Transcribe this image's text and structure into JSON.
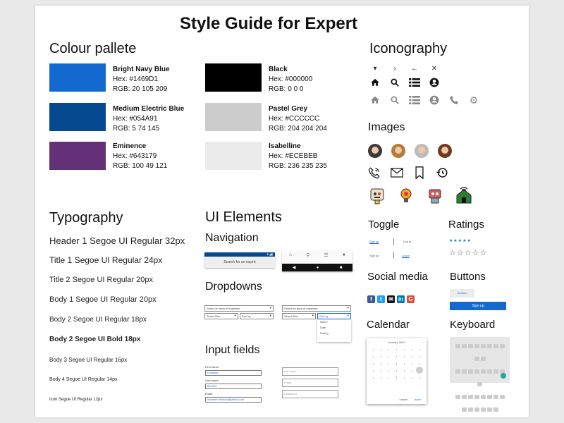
{
  "page": {
    "title": "Style Guide for Expert"
  },
  "colour": {
    "heading": "Colour pallete",
    "swatches": [
      {
        "name": "Bright Navy Blue",
        "hex": "Hex: #1469D1",
        "rgb": "RGB: 20 105 209",
        "color": "#1469D1"
      },
      {
        "name": "Medium Electric Blue",
        "hex": "Hex: #054A91",
        "rgb": "RGB: 5 74 145",
        "color": "#054A91"
      },
      {
        "name": "Eminence",
        "hex": "Hex: #643179",
        "rgb": "RGB: 100 49 121",
        "color": "#643179"
      },
      {
        "name": "Black",
        "hex": "Hex: #000000",
        "rgb": "RGB: 0 0 0",
        "color": "#000000"
      },
      {
        "name": "Pastel Grey",
        "hex": "Hex: #CCCCCC",
        "rgb": "RGB: 204 204 204",
        "color": "#CCCCCC"
      },
      {
        "name": "Isabelline",
        "hex": "Hex: #ECEBEB",
        "rgb": "RGB: 236 235 235",
        "color": "#ECEBEB"
      }
    ]
  },
  "typography": {
    "heading": "Typography",
    "samples": [
      "Header 1 Segoe UI Regular 32px",
      "Title 1 Segoe UI Regular 24px",
      "Title 2 Segoe UI Regular 20px",
      "Body 1 Segoe UI Regular 20px",
      "Body 2 Segoe UI Regular 18px",
      "Body 2 Segoe UI Bold 18px",
      "Body 3 Segoe UI Regular 16px",
      "Body 4 Segoe UI Regular 14px",
      "Icon Segoe UI Regular 12px"
    ]
  },
  "ui": {
    "heading": "UI Elements",
    "navigation": {
      "heading": "Navigation",
      "search_placeholder": "Search for an expert"
    },
    "dropdowns": {
      "heading": "Dropdowns",
      "area": "Select an area of expertise",
      "filter": "Select filter",
      "sort": "Sort by",
      "options": [
        "Sort by",
        "Name",
        "Date",
        "Rating"
      ]
    },
    "inputs": {
      "heading": "Input fields",
      "first_label": "First name",
      "first_value": "Lorianne",
      "last_label": "Last name",
      "last_value": "Benson",
      "email_label": "Email",
      "email_value": "lorianne.benson@yahoo.com",
      "full_placeholder": "Full name",
      "email_placeholder": "Email",
      "password_placeholder": "Password"
    }
  },
  "iconography": {
    "heading": "Iconography"
  },
  "images": {
    "heading": "Images"
  },
  "toggle": {
    "heading": "Toggle",
    "signup": "Sign up",
    "login": "Log in"
  },
  "ratings": {
    "heading": "Ratings",
    "filled": "★★★★★",
    "empty": "☆☆☆☆☆"
  },
  "social": {
    "heading": "Social media"
  },
  "buttons": {
    "heading": "Buttons",
    "confirm": "Confirm",
    "signup": "Sign up"
  },
  "calendar": {
    "heading": "Calendar",
    "month": "January 2020",
    "cancel": "cancel",
    "done": "done"
  },
  "keyboard": {
    "heading": "Keyboard"
  },
  "colors": {
    "accent": "#1469D1",
    "navy": "#054A91",
    "eminence": "#643179"
  }
}
